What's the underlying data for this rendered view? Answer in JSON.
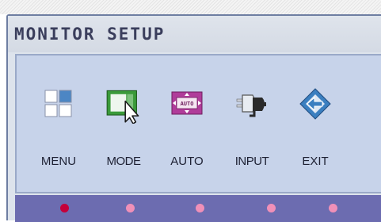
{
  "osd": {
    "title": "MONITOR SETUP",
    "items": [
      {
        "label": "MENU",
        "icon": "menu-grid-icon"
      },
      {
        "label": "MODE",
        "icon": "mode-window-cursor-icon"
      },
      {
        "label": "AUTO",
        "icon": "auto-adjust-icon",
        "badge": "AUTO"
      },
      {
        "label": "INPUT",
        "icon": "input-connector-icon"
      },
      {
        "label": "EXIT",
        "icon": "exit-arrow-icon"
      }
    ],
    "selected_index": 0,
    "colors": {
      "dot_selected": "#c4003a",
      "dot_normal": "#f090b8",
      "mode_green": "#3a9a3a",
      "auto_purple": "#b03c9a",
      "exit_blue": "#3b7fc0"
    }
  }
}
